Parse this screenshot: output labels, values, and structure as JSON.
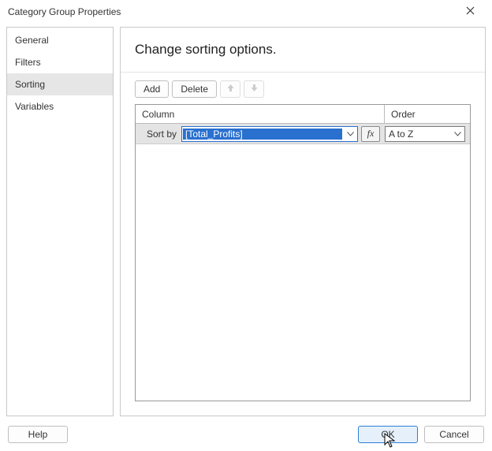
{
  "window": {
    "title": "Category Group Properties"
  },
  "sidebar": {
    "items": [
      {
        "label": "General",
        "selected": false
      },
      {
        "label": "Filters",
        "selected": false
      },
      {
        "label": "Sorting",
        "selected": true
      },
      {
        "label": "Variables",
        "selected": false
      }
    ]
  },
  "main": {
    "heading": "Change sorting options."
  },
  "toolbar": {
    "add_label": "Add",
    "delete_label": "Delete"
  },
  "grid": {
    "headers": {
      "column": "Column",
      "order": "Order"
    },
    "rows": [
      {
        "label": "Sort by",
        "expression": "[Total_Profits]",
        "order": "A to Z"
      }
    ]
  },
  "icons": {
    "fx_label": "fx"
  },
  "footer": {
    "help_label": "Help",
    "ok_label": "OK",
    "cancel_label": "Cancel"
  }
}
